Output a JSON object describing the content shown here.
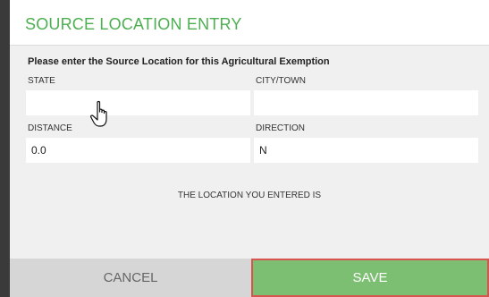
{
  "dialog": {
    "title": "SOURCE LOCATION ENTRY",
    "instruction": "Please enter the Source Location for this Agricultural Exemption"
  },
  "fields": {
    "state": {
      "label": "STATE",
      "value": ""
    },
    "city": {
      "label": "CITY/TOWN",
      "value": ""
    },
    "distance": {
      "label": "DISTANCE",
      "value": "0.0"
    },
    "direction": {
      "label": "DIRECTION",
      "value": "N"
    }
  },
  "result": {
    "text": "THE LOCATION YOU ENTERED IS"
  },
  "buttons": {
    "cancel_label": "CANCEL",
    "save_label": "SAVE"
  },
  "colors": {
    "accent": "#4caf50",
    "save_bg": "#7dbf72",
    "save_border": "#d9534f",
    "cancel_bg": "#d6d6d6"
  },
  "icons": {
    "cursor": "hand-pointer-icon"
  }
}
